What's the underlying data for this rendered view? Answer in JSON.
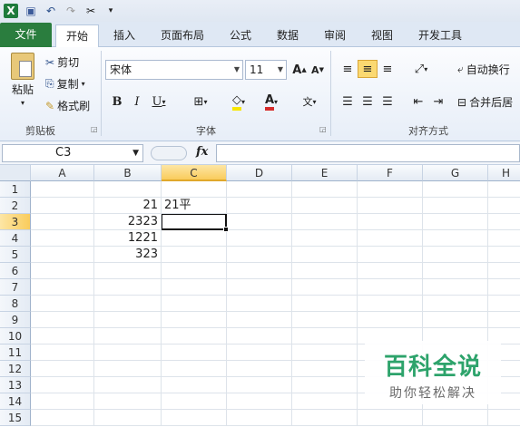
{
  "tabs": [
    "文件",
    "开始",
    "插入",
    "页面布局",
    "公式",
    "数据",
    "审阅",
    "视图",
    "开发工具"
  ],
  "clipboard": {
    "paste": "粘贴",
    "cut": "剪切",
    "copy": "复制",
    "format_painter": "格式刷",
    "group": "剪贴板"
  },
  "font": {
    "name": "宋体",
    "size": "11",
    "group": "字体"
  },
  "align": {
    "wrap": "自动换行",
    "merge": "合并后居",
    "group": "对齐方式"
  },
  "namebox": "C3",
  "fx": "fx",
  "columns": [
    "A",
    "B",
    "C",
    "D",
    "E",
    "F",
    "G",
    "H"
  ],
  "rows": [
    "1",
    "2",
    "3",
    "4",
    "5",
    "6",
    "7",
    "8",
    "9",
    "10",
    "11",
    "12",
    "13",
    "14",
    "15"
  ],
  "cells": {
    "B2": "21",
    "C2": "21平",
    "B3": "2323",
    "B4": "1221",
    "B5": "323"
  },
  "watermark": {
    "line1": "百科全说",
    "line2": "助你轻松解决"
  },
  "colors": {
    "file_tab": "#2a7d3e",
    "selected_header": "#f9cc5c",
    "watermark": "#2da36b"
  }
}
